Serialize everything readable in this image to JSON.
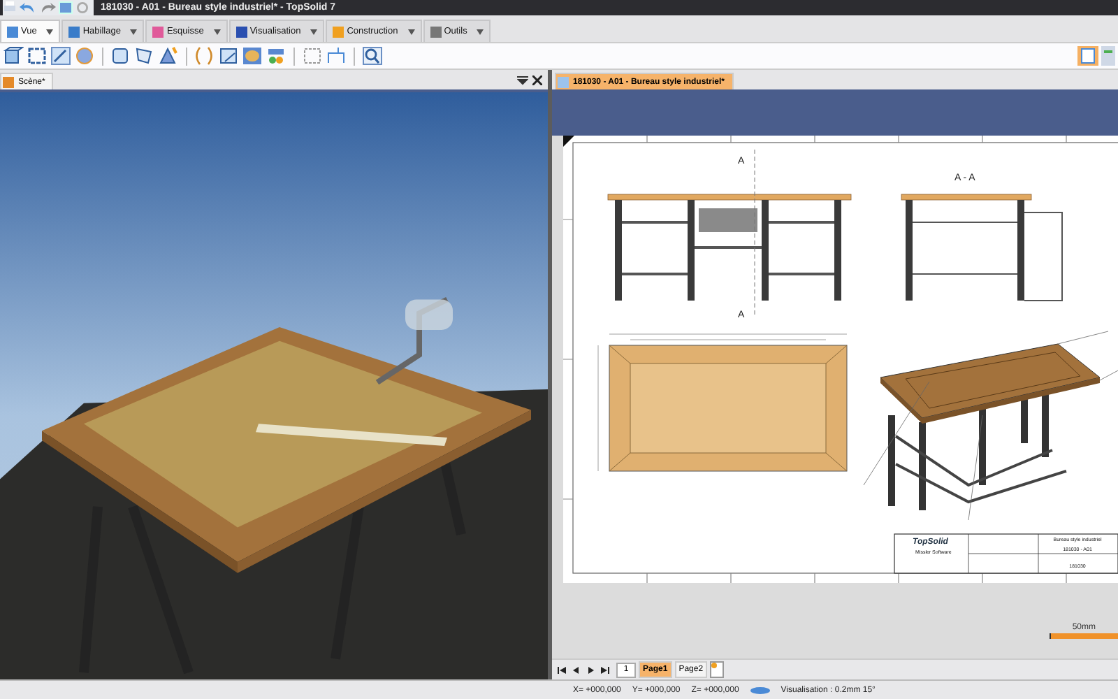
{
  "window": {
    "title": "181030 - A01 - Bureau style industriel* - TopSolid 7"
  },
  "ribbon_tabs": [
    {
      "label": "Vue",
      "selected": true
    },
    {
      "label": "Habillage",
      "selected": false
    },
    {
      "label": "Esquisse",
      "selected": false
    },
    {
      "label": "Visualisation",
      "selected": false
    },
    {
      "label": "Construction",
      "selected": false
    },
    {
      "label": "Outils",
      "selected": false
    }
  ],
  "scene_panel": {
    "tab": "Scène*"
  },
  "document_panel": {
    "tab": "181030 - A01 - Bureau style industriel*"
  },
  "drawing": {
    "section_title": "A - A",
    "cut_labels": [
      "A",
      "A"
    ],
    "title_block": {
      "logo": "TopSolid",
      "company": "Missler Software",
      "title": "Bureau style industriel",
      "reference": "181030 - A01",
      "number": "181030"
    }
  },
  "scale_bar": {
    "label": "50mm"
  },
  "page_nav": {
    "page_field": "1",
    "pages": [
      {
        "label": "Page1",
        "selected": true
      },
      {
        "label": "Page2",
        "selected": false
      }
    ]
  },
  "status_bar": {
    "x": "X= +000,000",
    "y": "Y= +000,000",
    "z": "Z= +000,000",
    "visualisation": "Visualisation : 0.2mm 15°"
  }
}
